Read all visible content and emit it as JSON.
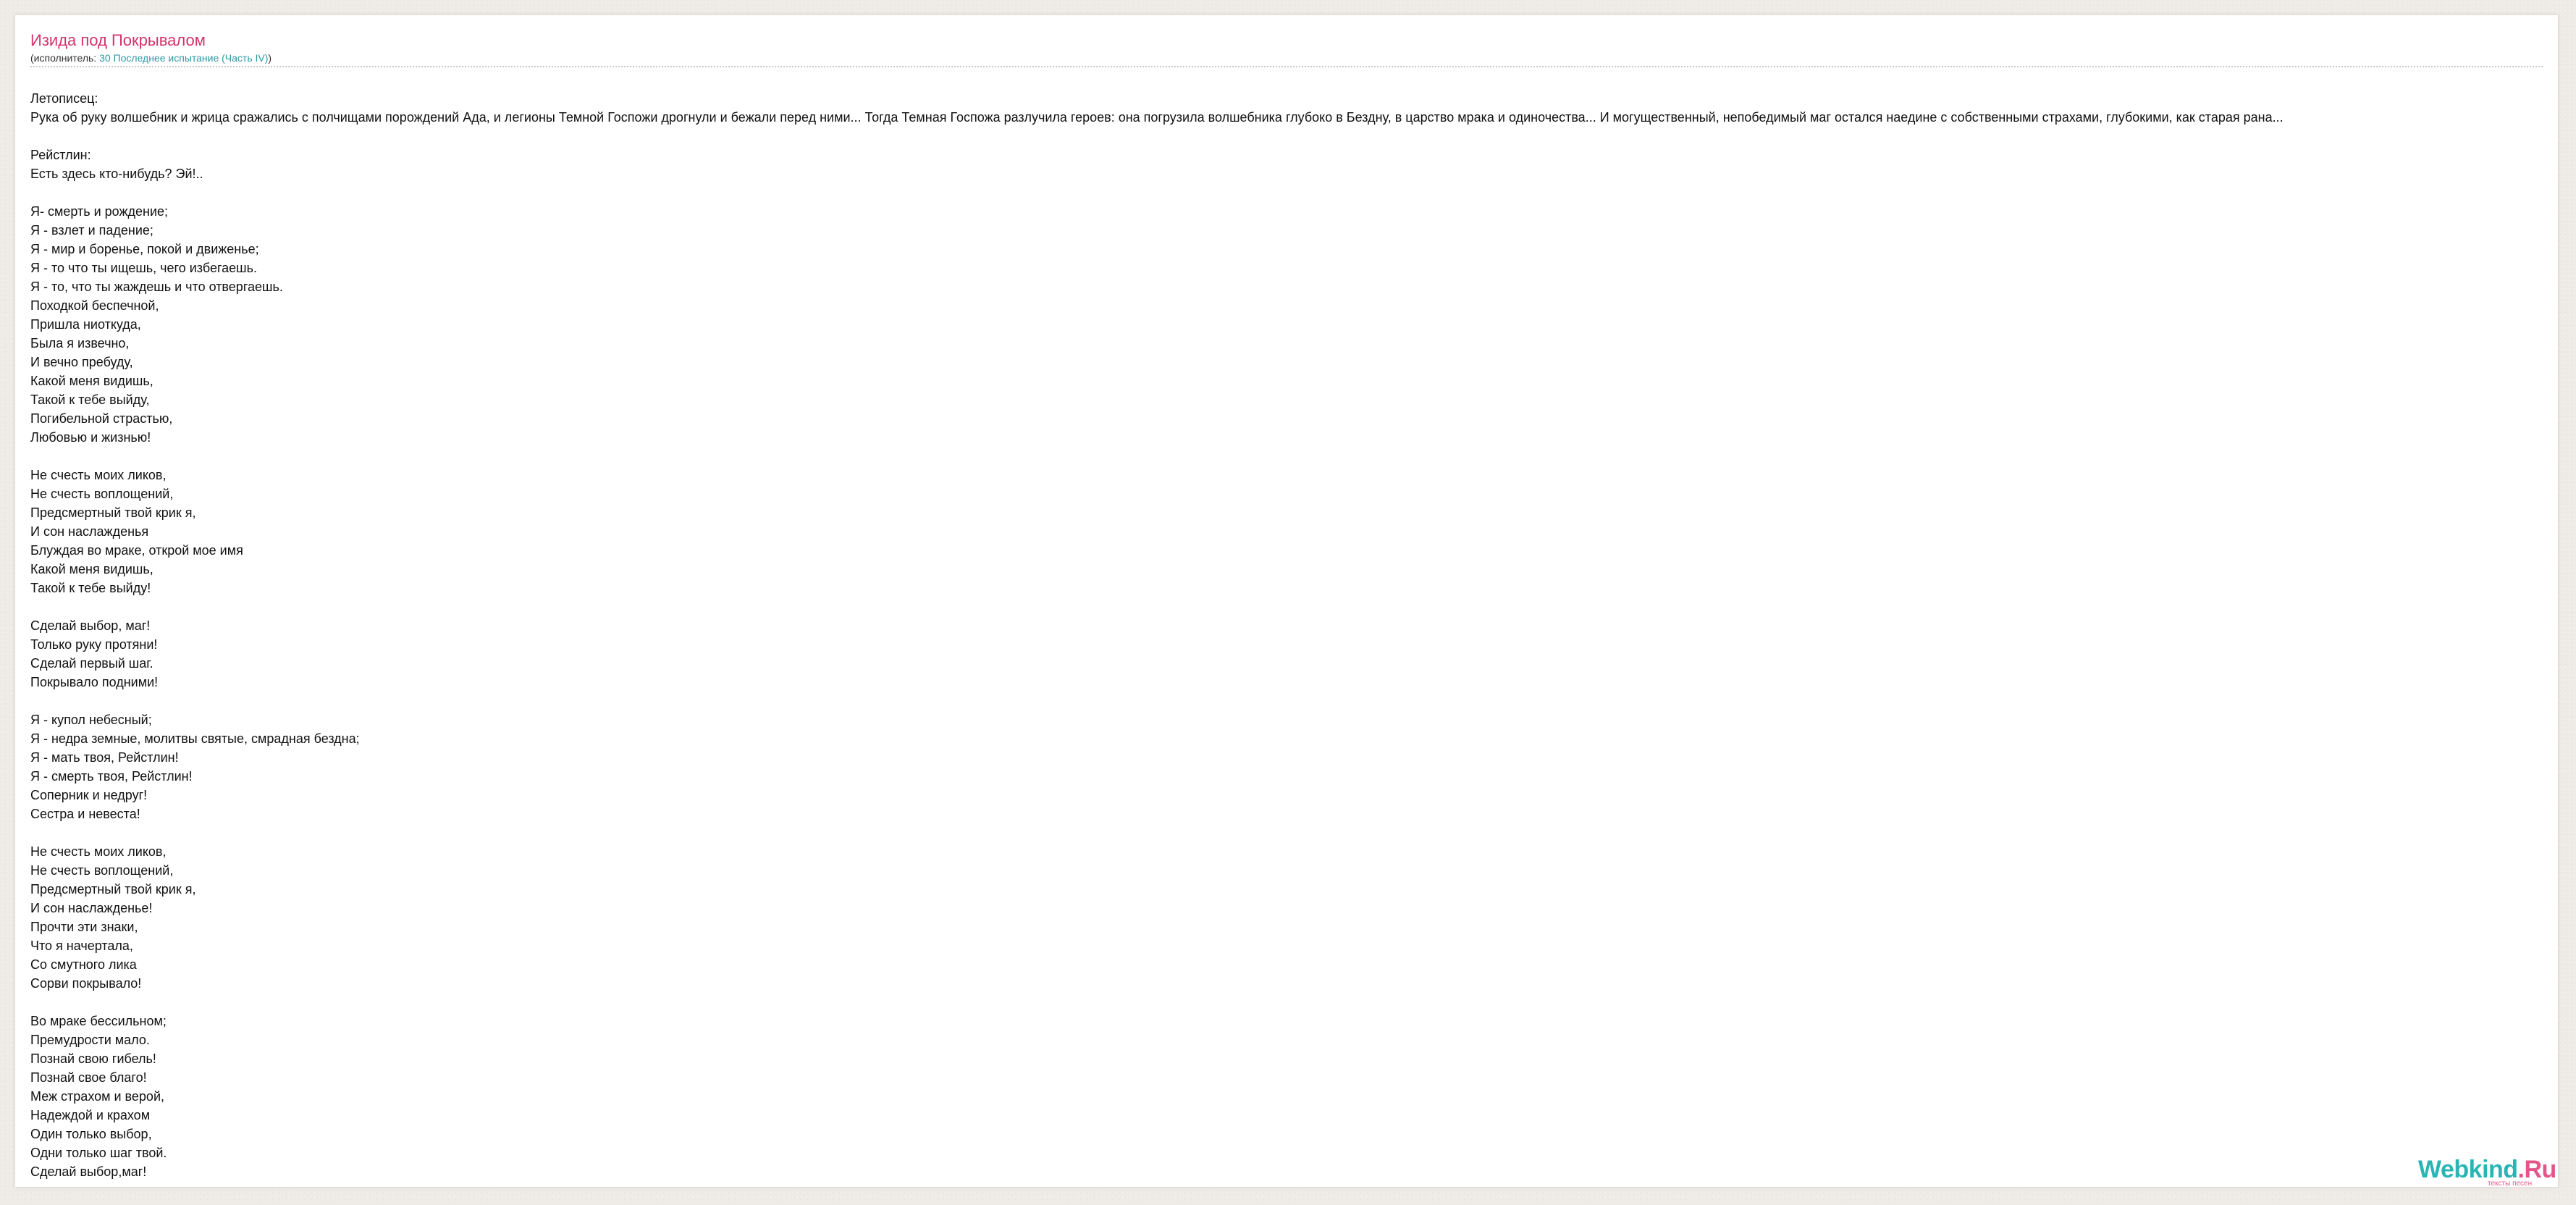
{
  "song": {
    "title": "Изида под Покрывалом",
    "performer_prefix": "(исполнитель: ",
    "performer_name": "30 Последнее испытание (Часть IV)",
    "performer_suffix": ")"
  },
  "lyrics": [
    "Летописец:",
    "Рука об руку волшебник и жрица сражались с полчищами порождений Ада, и легионы Темной Госпожи дрогнули и бежали перед ними... Тогда Темная Госпожа разлучила героев: она погрузила волшебника глубоко в Бездну, в царство мрака и одиночества... И могущественный, непобедимый маг остался наедине с собственными страхами, глубокими, как старая рана...",
    "",
    "Рейстлин:",
    "Есть здесь кто-нибудь? Эй!..",
    "",
    "Я- смерть и рождение;",
    "Я - взлет и падение;",
    "Я - мир и боренье, покой и движенье;",
    "Я - то что ты ищешь, чего избегаешь.",
    "Я - то, что ты жаждешь и что отвергаешь.",
    "Походкой беспечной,",
    "Пришла ниоткуда,",
    "Была я извечно,",
    "И вечно пребуду,",
    "Какой меня видишь,",
    "Такой к тебе выйду,",
    "Погибельной страстью,",
    "Любовью и жизнью!",
    "",
    "Не счесть моих ликов,",
    "Не счесть воплощений,",
    "Предсмертный твой крик я,",
    "И сон наслажденья",
    "Блуждая во мраке, открой мое имя",
    "Какой меня видишь,",
    "Такой к тебе выйду!",
    "",
    "Сделай выбор, маг!",
    "Только руку протяни!",
    "Сделай первый шаг.",
    "Покрывало подними!",
    "",
    "Я - купол небесный;",
    "Я - недра земные, молитвы святые, смрадная бездна;",
    "Я - мать твоя, Рейстлин!",
    "Я - смерть твоя, Рейстлин!",
    "Соперник и недруг!",
    "Сестра и невеста!",
    "",
    "Не счесть моих ликов,",
    "Не счесть воплощений,",
    "Предсмертный твой крик я,",
    "И сон наслажденье!",
    "Прочти эти знаки,",
    "Что я начертала,",
    "Со смутного лика",
    "Сорви покрывало!",
    "",
    "Во мраке бессильном;",
    "Премудрости мало.",
    "Познай свою гибель!",
    "Познай свое благо!",
    "Меж страхом и верой,",
    "Надеждой и крахом",
    "Один только выбор,",
    "Одни только шаг твой.",
    "Сделай выбор,маг!"
  ],
  "logo": {
    "word": "Webkind",
    "dot": ".Ru",
    "tagline": "тексты песен",
    "colors": {
      "word": "#28b5b3",
      "dot": "#e2568a"
    }
  },
  "colors": {
    "title": "#d4336b",
    "link": "#2a9aa3",
    "background": "#eeebe6",
    "page": "#ffffff"
  }
}
